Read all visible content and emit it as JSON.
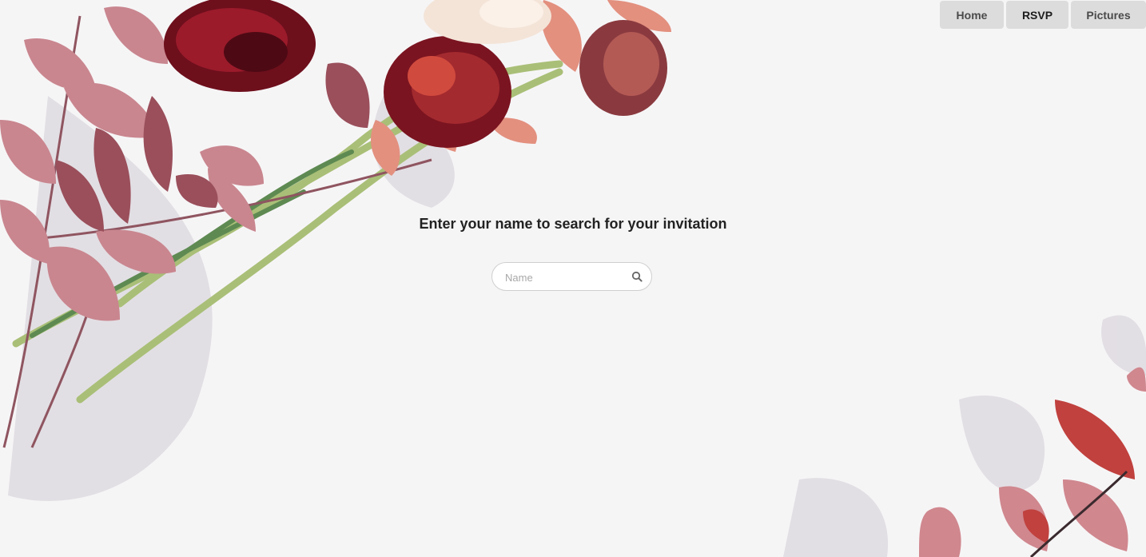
{
  "nav": {
    "items": [
      {
        "label": "Home"
      },
      {
        "label": "RSVP"
      },
      {
        "label": "Pictures"
      }
    ]
  },
  "main": {
    "heading": "Enter your name to search for your invitation",
    "search": {
      "placeholder": "Name",
      "value": "",
      "icon": "search-icon"
    }
  },
  "colors": {
    "background": "#f6f5f6",
    "nav_button": "#dcdcdc",
    "heading_text": "#222222",
    "flower_dark_red": "#7a1420",
    "flower_pink": "#d98b86",
    "leaf_mauve": "#b77a80",
    "stem_green": "#a8bf78"
  }
}
